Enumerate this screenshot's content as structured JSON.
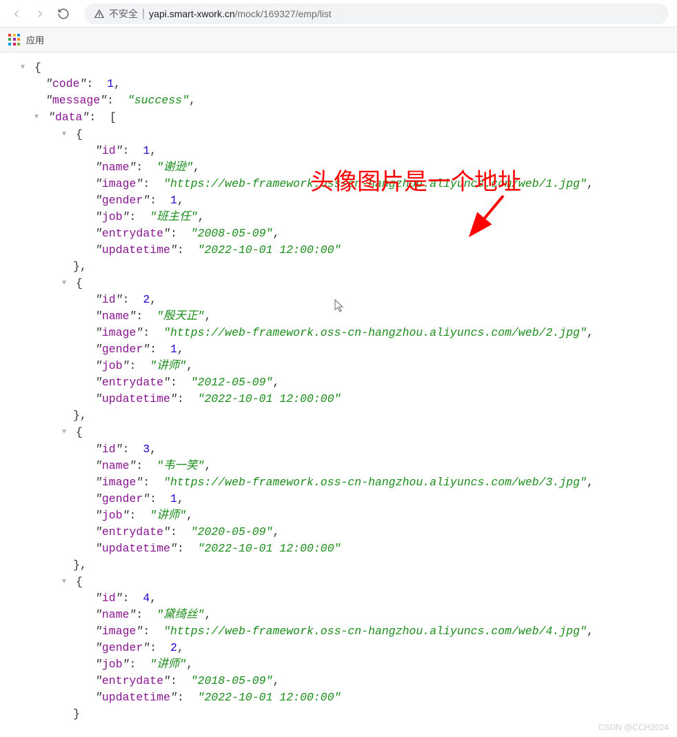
{
  "browser": {
    "insecure_label": "不安全",
    "url_host": "yapi.smart-xwork.cn",
    "url_path": "/mock/169327/emp/list",
    "apps_label": "应用"
  },
  "annotation": {
    "text": "头像图片是一个地址"
  },
  "watermark": "CSDN @CCH2024",
  "json": {
    "keys": {
      "code": "code",
      "message": "message",
      "data": "data",
      "id": "id",
      "name": "name",
      "image": "image",
      "gender": "gender",
      "job": "job",
      "entrydate": "entrydate",
      "updatetime": "updatetime"
    },
    "code": "1",
    "message": "success",
    "items": [
      {
        "id": "1",
        "name": "谢逊",
        "image": "https://web-framework.oss-cn-hangzhou.aliyuncs.com/web/1.jpg",
        "gender": "1",
        "job": "班主任",
        "entrydate": "2008-05-09",
        "updatetime": "2022-10-01 12:00:00"
      },
      {
        "id": "2",
        "name": "殷天正",
        "image": "https://web-framework.oss-cn-hangzhou.aliyuncs.com/web/2.jpg",
        "gender": "1",
        "job": "讲师",
        "entrydate": "2012-05-09",
        "updatetime": "2022-10-01 12:00:00"
      },
      {
        "id": "3",
        "name": "韦一笑",
        "image": "https://web-framework.oss-cn-hangzhou.aliyuncs.com/web/3.jpg",
        "gender": "1",
        "job": "讲师",
        "entrydate": "2020-05-09",
        "updatetime": "2022-10-01 12:00:00"
      },
      {
        "id": "4",
        "name": "黛绮丝",
        "image": "https://web-framework.oss-cn-hangzhou.aliyuncs.com/web/4.jpg",
        "gender": "2",
        "job": "讲师",
        "entrydate": "2018-05-09",
        "updatetime": "2022-10-01 12:00:00"
      }
    ]
  }
}
